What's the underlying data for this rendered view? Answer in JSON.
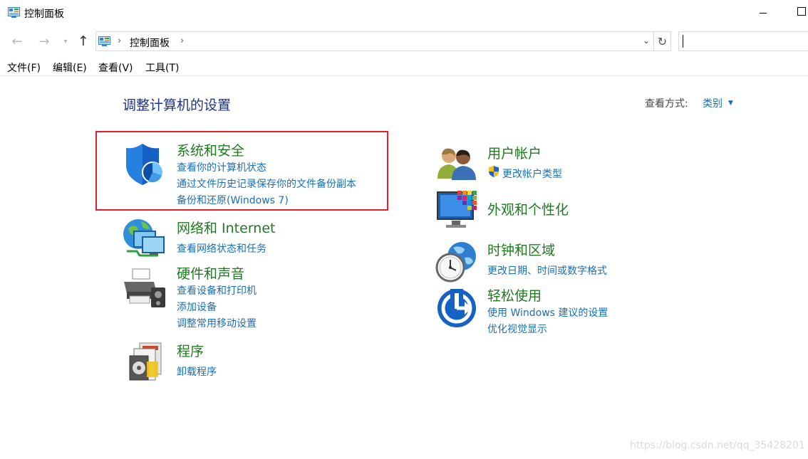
{
  "window": {
    "title": "控制面板"
  },
  "navigation": {
    "address_path": "控制面板",
    "search_placeholder": ""
  },
  "menu": {
    "items": [
      "文件(F)",
      "编辑(E)",
      "查看(V)",
      "工具(T)"
    ]
  },
  "main": {
    "heading": "调整计算机的设置",
    "view_by_label": "查看方式:",
    "view_by_value": "类别"
  },
  "categories": {
    "system_security": {
      "title": "系统和安全",
      "links": [
        "查看你的计算机状态",
        "通过文件历史记录保存你的文件备份副本",
        "备份和还原(Windows 7)"
      ]
    },
    "network": {
      "title": "网络和 Internet",
      "links": [
        "查看网络状态和任务"
      ]
    },
    "hardware": {
      "title": "硬件和声音",
      "links": [
        "查看设备和打印机",
        "添加设备",
        "调整常用移动设置"
      ]
    },
    "programs": {
      "title": "程序",
      "links": [
        "卸载程序"
      ]
    },
    "user_accounts": {
      "title": "用户帐户",
      "links": [
        "更改帐户类型"
      ]
    },
    "appearance": {
      "title": "外观和个性化"
    },
    "clock_region": {
      "title": "时钟和区域",
      "links": [
        "更改日期、时间或数字格式"
      ]
    },
    "ease_of_access": {
      "title": "轻松使用",
      "links": [
        "使用 Windows 建议的设置",
        "优化视觉显示"
      ]
    }
  },
  "watermark": "https://blog.csdn.net/qq_35428201",
  "colors": {
    "category_title": "#1e7a1e",
    "link": "#1a6fb3",
    "heading": "#1e3287",
    "highlight": "#e0202a"
  }
}
